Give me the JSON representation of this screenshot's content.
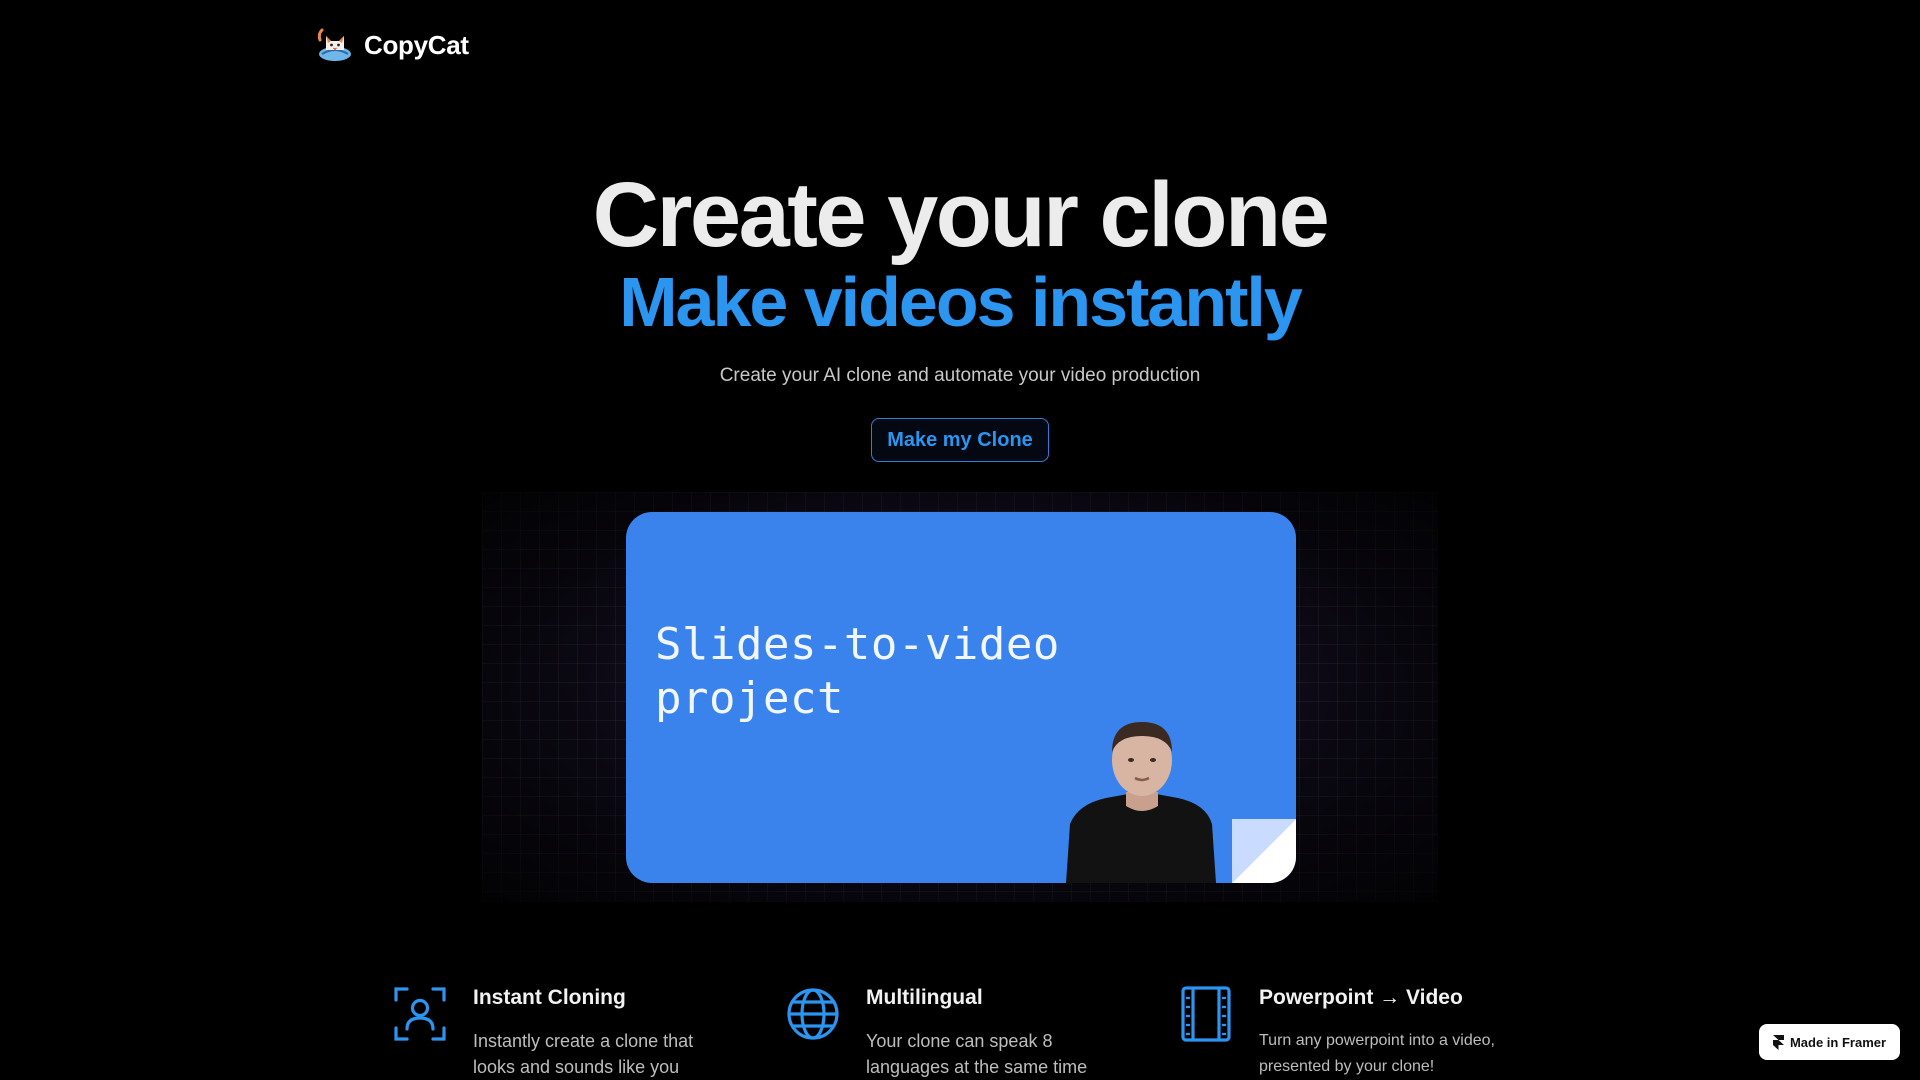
{
  "brand": {
    "name": "CopyCat",
    "logo_icon": "cat-logo-icon"
  },
  "hero": {
    "title": "Create your clone",
    "accent": "Make videos instantly",
    "subtitle": "Create your AI clone and automate your video production",
    "cta_label": "Make my Clone"
  },
  "showcase": {
    "slide_title_line1": "Slides-to-video",
    "slide_title_line2": "project",
    "slide_color": "#3b83ec"
  },
  "features": [
    {
      "icon": "person-scan-icon",
      "title": "Instant Cloning",
      "desc": "Instantly create a clone that looks and sounds like you"
    },
    {
      "icon": "globe-icon",
      "title": "Multilingual",
      "desc": "Your clone can speak 8 languages at the same time"
    },
    {
      "icon": "film-strip-icon",
      "title": "Powerpoint → Video",
      "desc": "Turn any powerpoint into a video, presented by your clone!"
    }
  ],
  "badge": {
    "label": "Made in Framer",
    "icon": "framer-logo-icon"
  },
  "colors": {
    "accent": "#2b95f0",
    "background": "#000000"
  }
}
